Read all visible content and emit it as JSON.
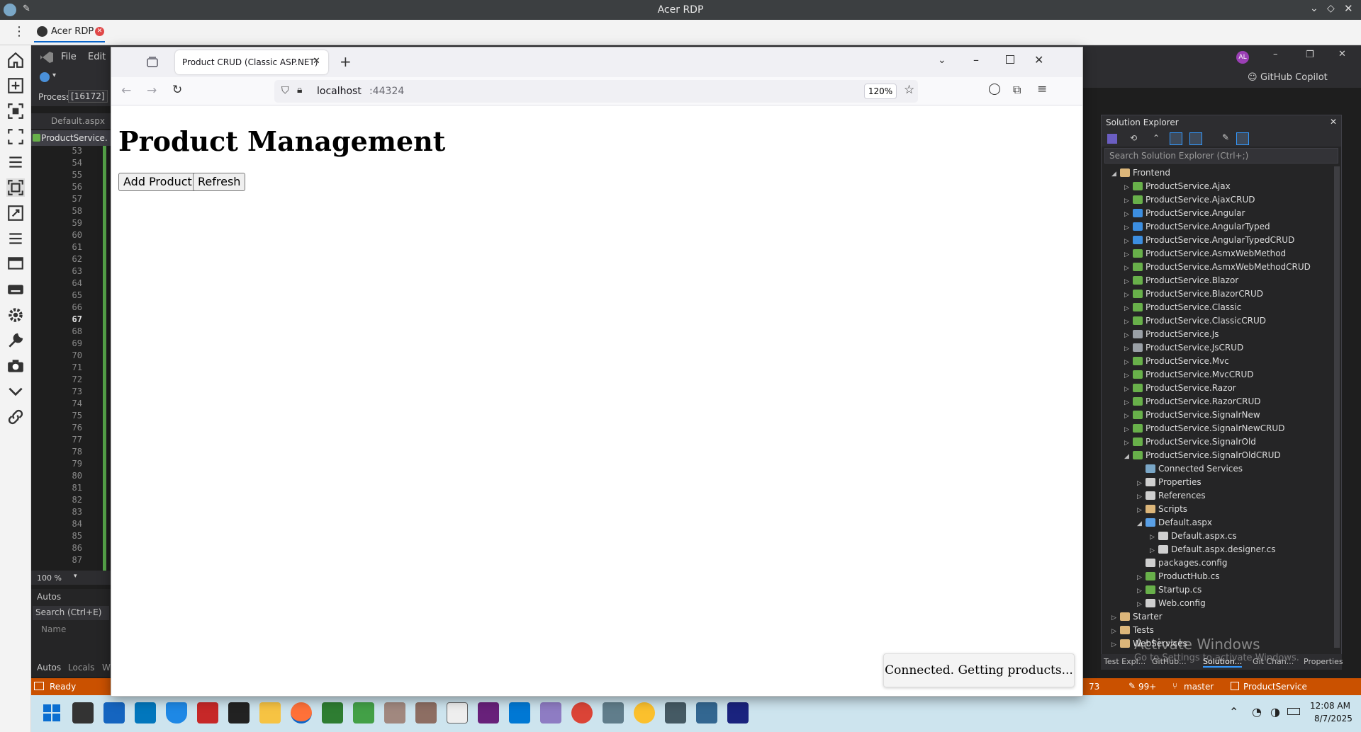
{
  "rdp": {
    "title": "Acer RDP",
    "tab_label": "Acer RDP"
  },
  "vs": {
    "menu_file": "File",
    "menu_edit": "Edit",
    "process_label": "Process:",
    "process_value": "[16172]",
    "doc_tab_1": "Default.aspx",
    "doc_tab_2": "ProductService.",
    "line_numbers": [
      "53",
      "54",
      "55",
      "56",
      "57",
      "58",
      "59",
      "60",
      "61",
      "62",
      "63",
      "64",
      "65",
      "66",
      "67",
      "68",
      "69",
      "70",
      "71",
      "72",
      "73",
      "74",
      "75",
      "76",
      "77",
      "78",
      "79",
      "80",
      "81",
      "82",
      "83",
      "84",
      "85",
      "86",
      "87"
    ],
    "current_line": "67",
    "zoom": "100 %",
    "autos_title": "Autos",
    "autos_search": "Search (Ctrl+E)",
    "autos_col_name": "Name",
    "bottom_tabs": [
      "Autos",
      "Locals",
      "W"
    ],
    "copilot": "GitHub Copilot",
    "avatar_initials": "AL"
  },
  "solution_explorer": {
    "title": "Solution Explorer",
    "search_placeholder": "Search Solution Explorer (Ctrl+;)",
    "items": [
      {
        "label": "Frontend",
        "indent": 0,
        "kind": "folder",
        "expanded": true
      },
      {
        "label": "ProductService.Ajax",
        "indent": 1,
        "kind": "proj"
      },
      {
        "label": "ProductService.AjaxCRUD",
        "indent": 1,
        "kind": "proj"
      },
      {
        "label": "ProductService.Angular",
        "indent": 1,
        "kind": "web"
      },
      {
        "label": "ProductService.AngularTyped",
        "indent": 1,
        "kind": "web"
      },
      {
        "label": "ProductService.AngularTypedCRUD",
        "indent": 1,
        "kind": "web"
      },
      {
        "label": "ProductService.AsmxWebMethod",
        "indent": 1,
        "kind": "proj"
      },
      {
        "label": "ProductService.AsmxWebMethodCRUD",
        "indent": 1,
        "kind": "proj"
      },
      {
        "label": "ProductService.Blazor",
        "indent": 1,
        "kind": "proj"
      },
      {
        "label": "ProductService.BlazorCRUD",
        "indent": 1,
        "kind": "proj"
      },
      {
        "label": "ProductService.Classic",
        "indent": 1,
        "kind": "proj"
      },
      {
        "label": "ProductService.ClassicCRUD",
        "indent": 1,
        "kind": "proj"
      },
      {
        "label": "ProductService.Js",
        "indent": 1,
        "kind": "globe"
      },
      {
        "label": "ProductService.JsCRUD",
        "indent": 1,
        "kind": "globe"
      },
      {
        "label": "ProductService.Mvc",
        "indent": 1,
        "kind": "proj"
      },
      {
        "label": "ProductService.MvcCRUD",
        "indent": 1,
        "kind": "proj"
      },
      {
        "label": "ProductService.Razor",
        "indent": 1,
        "kind": "proj"
      },
      {
        "label": "ProductService.RazorCRUD",
        "indent": 1,
        "kind": "proj"
      },
      {
        "label": "ProductService.SignalrNew",
        "indent": 1,
        "kind": "proj"
      },
      {
        "label": "ProductService.SignalrNewCRUD",
        "indent": 1,
        "kind": "proj"
      },
      {
        "label": "ProductService.SignalrOld",
        "indent": 1,
        "kind": "proj"
      },
      {
        "label": "ProductService.SignalrOldCRUD",
        "indent": 1,
        "kind": "proj",
        "expanded": true
      },
      {
        "label": "Connected Services",
        "indent": 2,
        "kind": "service",
        "leaf": true
      },
      {
        "label": "Properties",
        "indent": 2,
        "kind": "wrench"
      },
      {
        "label": "References",
        "indent": 2,
        "kind": "ref"
      },
      {
        "label": "Scripts",
        "indent": 2,
        "kind": "folder"
      },
      {
        "label": "Default.aspx",
        "indent": 2,
        "kind": "page",
        "expanded": true
      },
      {
        "label": "Default.aspx.cs",
        "indent": 3,
        "kind": "file"
      },
      {
        "label": "Default.aspx.designer.cs",
        "indent": 3,
        "kind": "file"
      },
      {
        "label": "packages.config",
        "indent": 2,
        "kind": "config",
        "leaf": true
      },
      {
        "label": "ProductHub.cs",
        "indent": 2,
        "kind": "cs"
      },
      {
        "label": "Startup.cs",
        "indent": 2,
        "kind": "cs"
      },
      {
        "label": "Web.config",
        "indent": 2,
        "kind": "config"
      },
      {
        "label": "Starter",
        "indent": 0,
        "kind": "folder"
      },
      {
        "label": "Tests",
        "indent": 0,
        "kind": "folder"
      },
      {
        "label": "WebServices",
        "indent": 0,
        "kind": "folder"
      }
    ],
    "bottom_tabs": [
      "Test Expl...",
      "GitHub...",
      "Solution...",
      "Git Chan...",
      "Properties"
    ]
  },
  "watermark": {
    "line1": "Activate Windows",
    "line2": "Go to Settings to activate Windows."
  },
  "status_bar": {
    "ready": "Ready",
    "errors": "73",
    "edits": "99+",
    "branch": "master",
    "project": "ProductService"
  },
  "taskbar": {
    "time": "12:08 AM",
    "date": "8/7/2025"
  },
  "browser": {
    "tab_title": "Product CRUD (Classic ASP.NET)",
    "url_host": "localhost",
    "url_port": ":44324",
    "zoom": "120%"
  },
  "page": {
    "heading": "Product Management",
    "add_button": "Add Product",
    "refresh_button": "Refresh",
    "toast": "Connected. Getting products..."
  },
  "colors": {
    "status_bar": "#ca5100",
    "green_change_bar": "#57a64a",
    "taskbar": "#cde4ee"
  }
}
